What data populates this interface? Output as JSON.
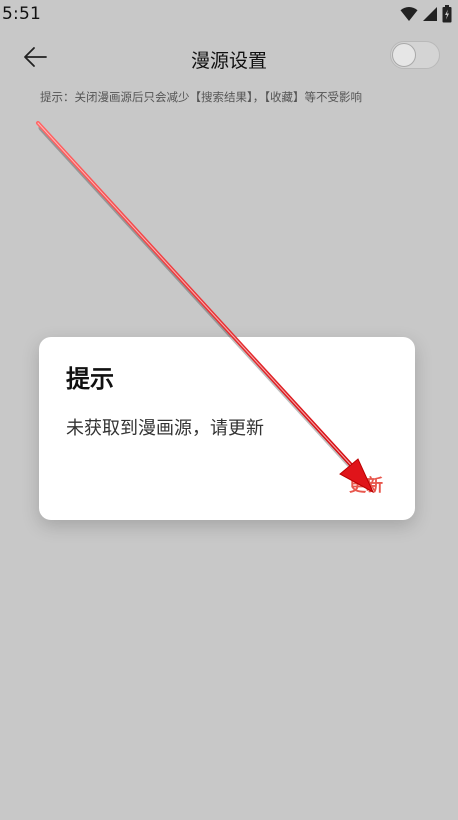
{
  "status_bar": {
    "time": "5:51",
    "icons": [
      "wifi-icon",
      "signal-icon",
      "battery-icon"
    ]
  },
  "header": {
    "title": "漫源设置",
    "back_icon": "arrow-left-icon",
    "toggle_on": false
  },
  "hint": "提示：关闭漫画源后只会减少【搜索结果】，【收藏】等不受影响",
  "dialog": {
    "title": "提示",
    "message": "未获取到漫画源，请更新",
    "button_label": "更新"
  },
  "colors": {
    "background": "#c8c8c8",
    "dialog_bg": "#ffffff",
    "accent": "#e8574d",
    "annotation_arrow": "#e0141a"
  }
}
